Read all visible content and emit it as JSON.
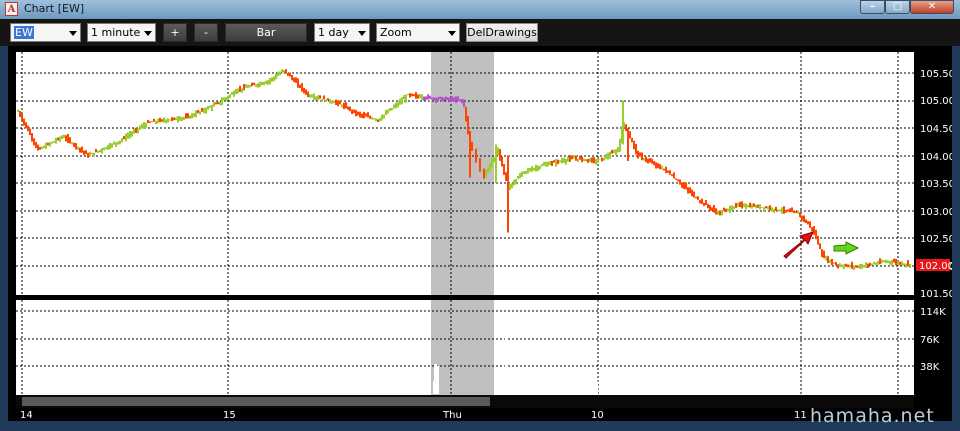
{
  "window": {
    "title": "Chart [EW]",
    "minimize_label": "–",
    "maximize_label": "□",
    "close_label": "✕"
  },
  "toolbar": {
    "symbol": "EW",
    "interval": "1 minute",
    "plus_label": "+",
    "minus_label": "-",
    "style_label": "Bar",
    "range": "1 day",
    "zoom": "Zoom",
    "del_drawings_label": "DelDrawings"
  },
  "price_axis": {
    "ticks": [
      "105.50",
      "105.00",
      "104.50",
      "104.00",
      "103.50",
      "103.00",
      "102.50",
      "102.00",
      "101.50"
    ],
    "last_price": "102.00"
  },
  "volume_axis": {
    "ticks": [
      "114K",
      "76K",
      "38K"
    ]
  },
  "time_axis": {
    "labels": [
      "14",
      "15",
      "Thu",
      "10",
      "11"
    ]
  },
  "colors": {
    "up": "#9acd32",
    "down": "#ff4500",
    "premarket": "#b455c8",
    "shade": "#c0c0c0",
    "arrow_red": "#e01010",
    "arrow_green": "#66d61a"
  },
  "watermark": "hamaha.net"
}
